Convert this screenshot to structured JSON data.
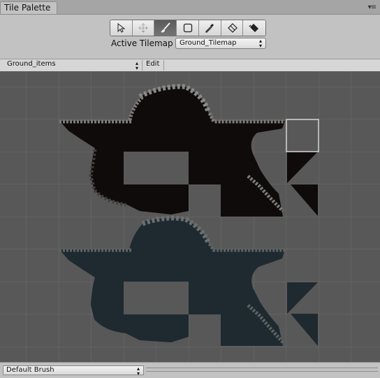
{
  "window": {
    "tab_title": "Tile Palette",
    "menu_icon": "context-menu-icon"
  },
  "toolbar": {
    "tools": [
      {
        "name": "select",
        "icon": "select-arrow-icon",
        "active": false
      },
      {
        "name": "move",
        "icon": "move-icon",
        "active": false
      },
      {
        "name": "paint",
        "icon": "paintbrush-icon",
        "active": true
      },
      {
        "name": "box-fill",
        "icon": "box-fill-icon",
        "active": false
      },
      {
        "name": "picker",
        "icon": "eyedropper-icon",
        "active": false
      },
      {
        "name": "erase",
        "icon": "eraser-icon",
        "active": false
      },
      {
        "name": "flood-fill",
        "icon": "fill-bucket-icon",
        "active": false
      }
    ]
  },
  "active_tilemap": {
    "label": "Active Tilemap",
    "value": "Ground_Tilemap"
  },
  "palette": {
    "selected": "Ground_items",
    "edit_label": "Edit"
  },
  "grid": {
    "selected_cell": {
      "row": 1,
      "col": 9
    }
  },
  "brush": {
    "value": "Default Brush"
  },
  "colors": {
    "background": "#585858",
    "grid_line": "#6c6c6c",
    "dark_tiles": "#0e0b0a",
    "teal_tiles": "#1e2a30",
    "rock_edge": "#8a8a86",
    "selection": "#d8d8d8"
  }
}
